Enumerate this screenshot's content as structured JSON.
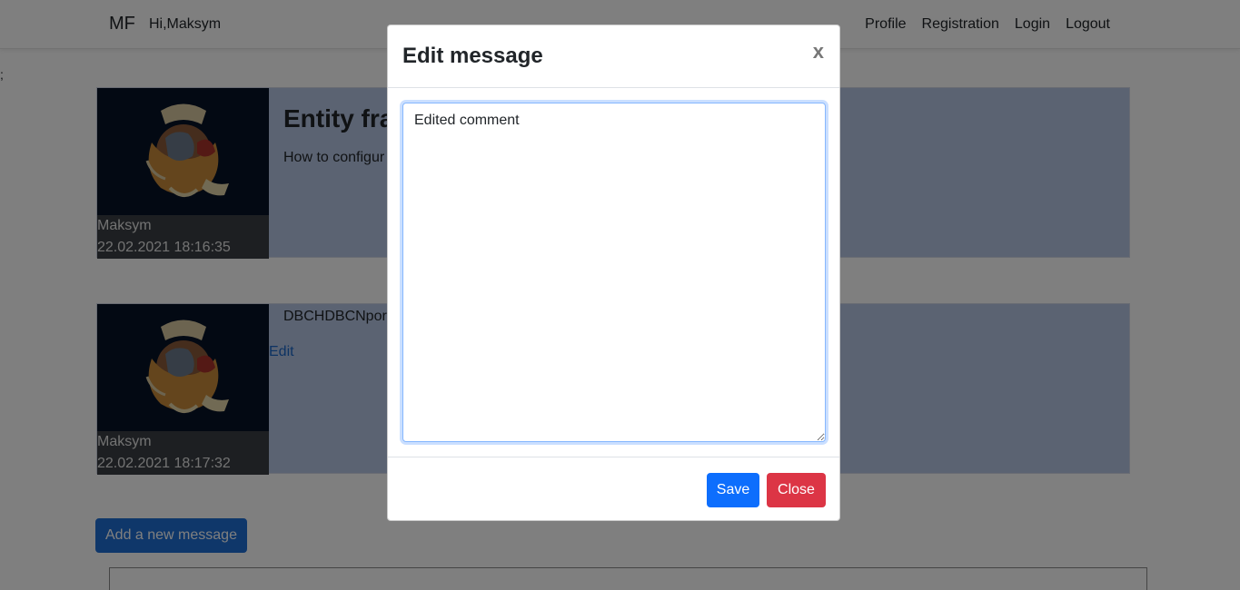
{
  "navbar": {
    "brand": "MF",
    "greeting": "Hi,Maksym",
    "links": [
      "Profile",
      "Registration",
      "Login",
      "Logout"
    ]
  },
  "stray_text": ";",
  "posts": [
    {
      "title": "Entity fra",
      "text": "How to configur",
      "author": "Maksym",
      "timestamp": "22.02.2021 18:16:35"
    },
    {
      "text": "DBCHDBCNpork",
      "edit_label": "Edit",
      "author": "Maksym",
      "timestamp": "22.02.2021 18:17:32"
    }
  ],
  "add_button_label": "Add a new message",
  "modal": {
    "title": "Edit message",
    "close_glyph": "x",
    "textarea_value": "Edited comment",
    "save_label": "Save",
    "close_label": "Close"
  },
  "colors": {
    "save": "#0d6efd",
    "close": "#dc3545",
    "card_bg": "#b6c6e4",
    "add_button": "#1f6ed4"
  }
}
